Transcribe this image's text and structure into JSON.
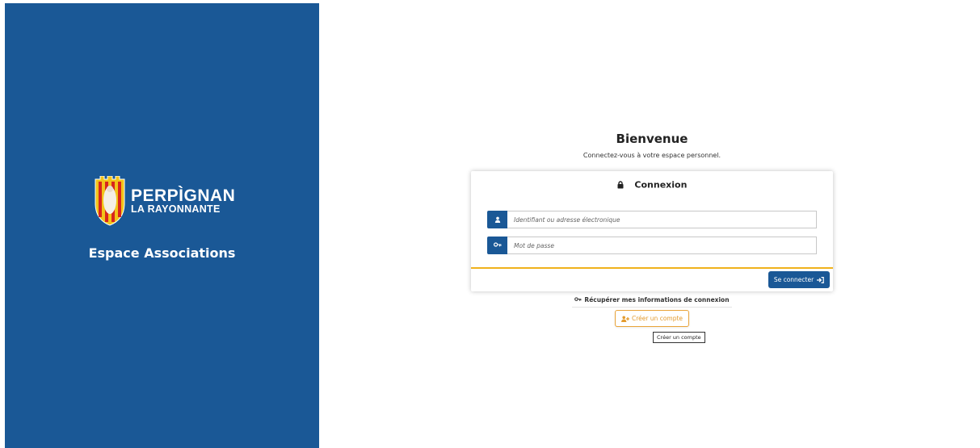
{
  "brand": {
    "logo_line1": "PERPÌGNAN",
    "logo_line2": "LA RAYONNANTE",
    "subtitle": "Espace Associations",
    "color": "#1a5896"
  },
  "welcome": {
    "title": "Bienvenue",
    "subtitle": "Connectez-vous à votre espace personnel."
  },
  "login_card": {
    "title": "Connexion",
    "title_icon": "lock-icon",
    "username": {
      "placeholder": "Identifiant ou adresse électronique",
      "value": "",
      "icon": "user-icon"
    },
    "password": {
      "placeholder": "Mot de passe",
      "value": "",
      "icon": "key-icon"
    },
    "submit_label": "Se connecter",
    "submit_icon": "sign-in-icon",
    "accent_color": "#f0b21c"
  },
  "links": {
    "recover_label": "Récupérer mes informations de connexion",
    "recover_icon": "key-icon",
    "create_label": "Créer un compte",
    "create_icon": "user-plus-icon",
    "create_color": "#e39b2e"
  },
  "tooltip": {
    "text": "Créer un compte"
  }
}
